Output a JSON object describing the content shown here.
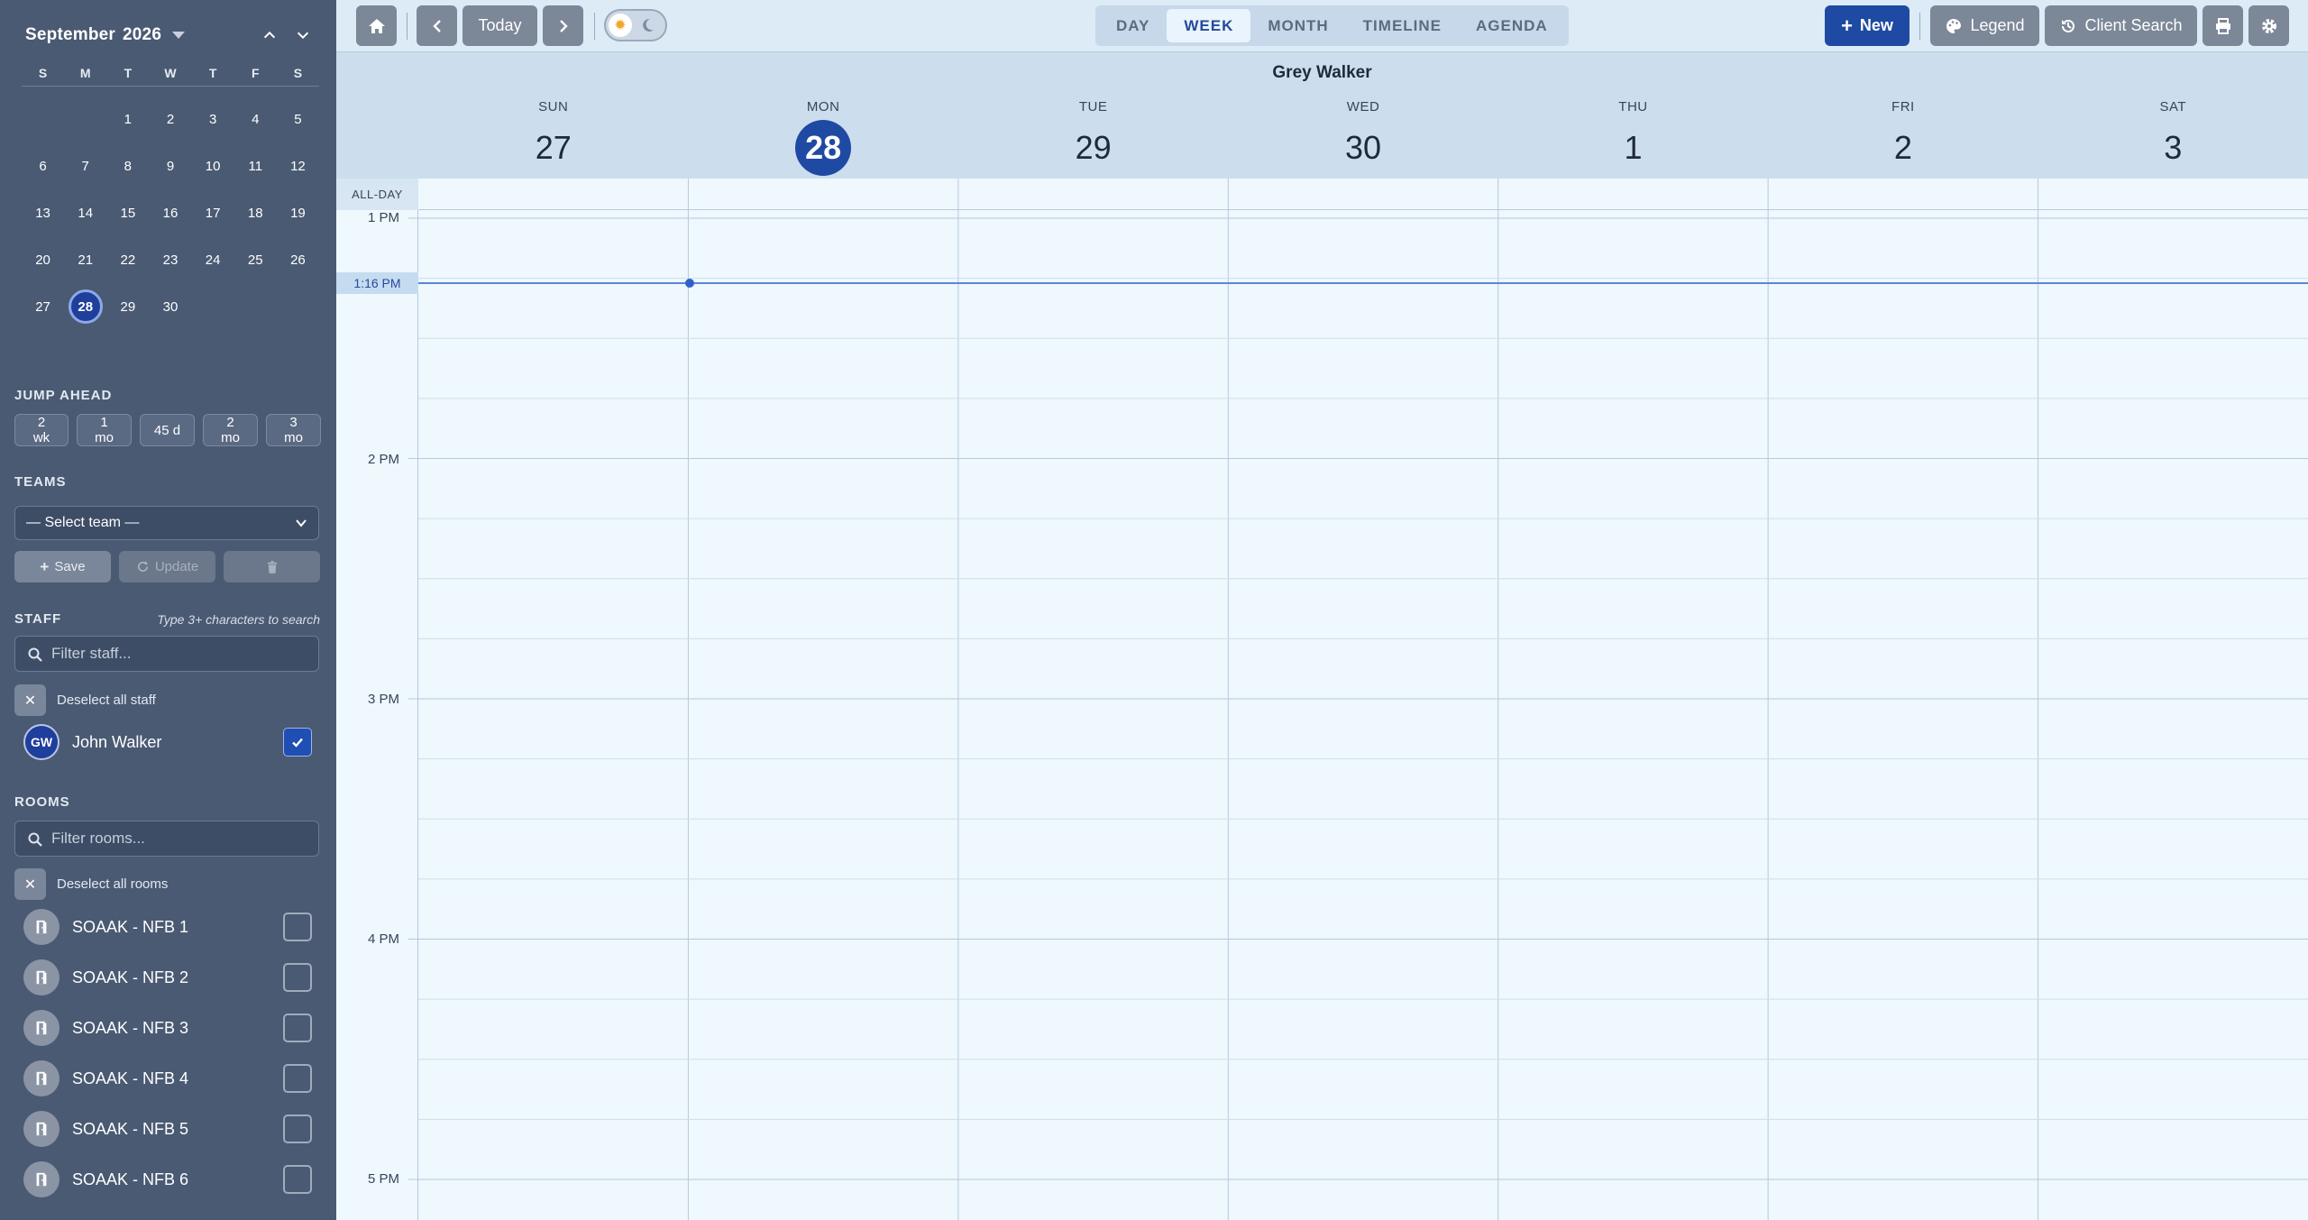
{
  "mini_calendar": {
    "month": "September",
    "year": "2026",
    "dow": [
      "S",
      "M",
      "T",
      "W",
      "T",
      "F",
      "S"
    ],
    "weeks": [
      [
        "",
        "",
        "1",
        "2",
        "3",
        "4",
        "5"
      ],
      [
        "6",
        "7",
        "8",
        "9",
        "10",
        "11",
        "12"
      ],
      [
        "13",
        "14",
        "15",
        "16",
        "17",
        "18",
        "19"
      ],
      [
        "20",
        "21",
        "22",
        "23",
        "24",
        "25",
        "26"
      ],
      [
        "27",
        "28",
        "29",
        "30",
        "",
        "",
        ""
      ]
    ],
    "selected": "28"
  },
  "jump_ahead": {
    "title": "JUMP AHEAD",
    "options": [
      "2 wk",
      "1 mo",
      "45 d",
      "2 mo",
      "3 mo"
    ]
  },
  "teams": {
    "title": "TEAMS",
    "select_value": "— Select team —",
    "save_label": "Save",
    "update_label": "Update"
  },
  "staff": {
    "title": "STAFF",
    "hint": "Type 3+ characters to search",
    "filter_placeholder": "Filter staff...",
    "deselect_label": "Deselect all staff",
    "members": [
      {
        "initials": "GW",
        "name": "John Walker",
        "checked": true
      }
    ]
  },
  "rooms": {
    "title": "ROOMS",
    "filter_placeholder": "Filter rooms...",
    "deselect_label": "Deselect all rooms",
    "items": [
      "SOAAK - NFB 1",
      "SOAAK - NFB 2",
      "SOAAK - NFB 3",
      "SOAAK - NFB 4",
      "SOAAK - NFB 5",
      "SOAAK - NFB 6"
    ]
  },
  "toolbar": {
    "today_label": "Today",
    "views": [
      "DAY",
      "WEEK",
      "MONTH",
      "TIMELINE",
      "AGENDA"
    ],
    "active_view": "WEEK",
    "new_label": "New",
    "legend_label": "Legend",
    "client_search_label": "Client Search"
  },
  "calendar": {
    "title": "Grey Walker",
    "days": [
      {
        "dow": "SUN",
        "date": "27"
      },
      {
        "dow": "MON",
        "date": "28",
        "today": true
      },
      {
        "dow": "TUE",
        "date": "29"
      },
      {
        "dow": "WED",
        "date": "30"
      },
      {
        "dow": "THU",
        "date": "1"
      },
      {
        "dow": "FRI",
        "date": "2"
      },
      {
        "dow": "SAT",
        "date": "3"
      }
    ],
    "all_day_label": "ALL-DAY",
    "time_labels": [
      "1 PM",
      "2 PM",
      "3 PM",
      "4 PM",
      "5 PM"
    ],
    "now_label": "1:16 PM"
  },
  "colors": {
    "accent": "#1f4aa3",
    "sidebar_bg": "#4a5a73",
    "now_line": "#5b86d6"
  }
}
